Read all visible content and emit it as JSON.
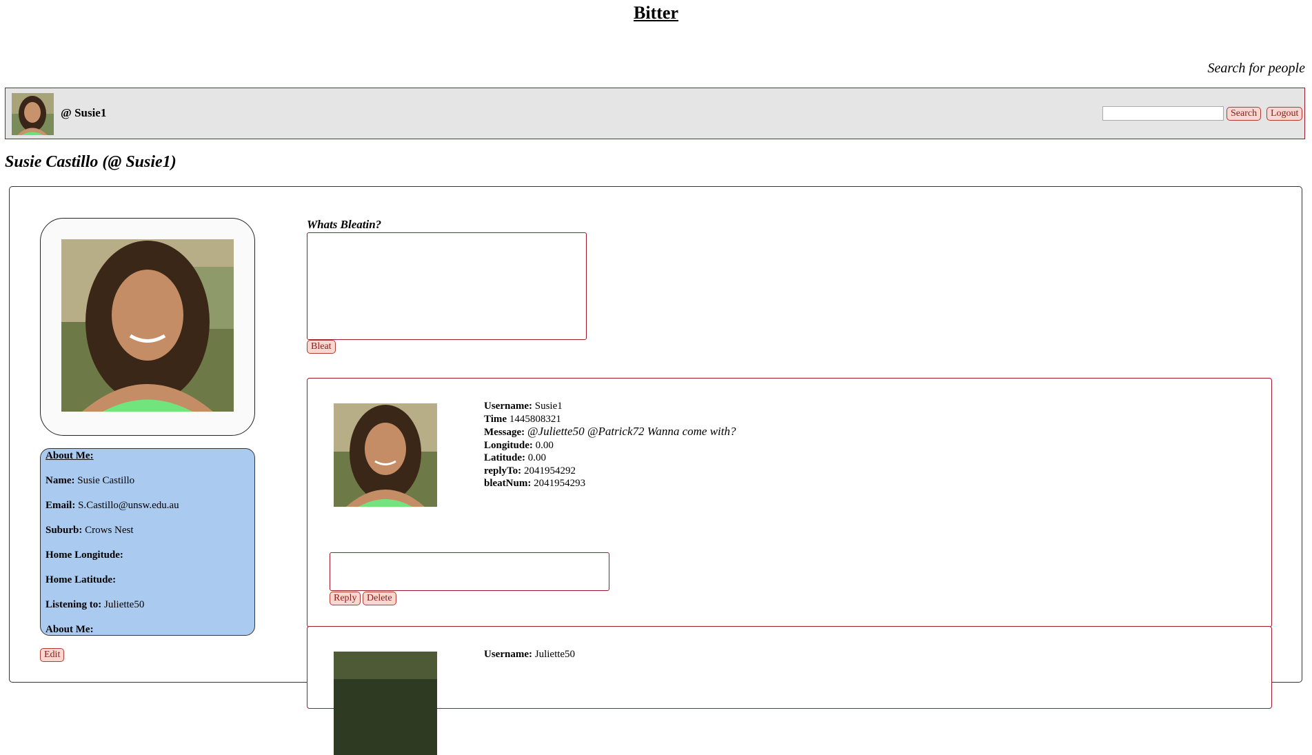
{
  "site": {
    "title": "Bitter"
  },
  "header": {
    "search_caption": "Search for people",
    "handle": "@ Susie1",
    "search_placeholder": "",
    "search_label": "Search",
    "logout_label": "Logout"
  },
  "profile": {
    "title": "Susie Castillo (@ Susie1)",
    "about": {
      "heading": "About Me:",
      "fields": [
        {
          "label": "Name:",
          "value": "Susie Castillo"
        },
        {
          "label": "Email:",
          "value": "S.Castillo@unsw.edu.au"
        },
        {
          "label": "Suburb:",
          "value": "Crows Nest"
        },
        {
          "label": "Home Longitude:",
          "value": ""
        },
        {
          "label": "Home Latitude:",
          "value": ""
        },
        {
          "label": "Listening to:",
          "value": "Juliette50"
        },
        {
          "label": "About Me:",
          "value": ""
        }
      ]
    },
    "edit_label": "Edit"
  },
  "compose": {
    "label": "Whats Bleatin?",
    "value": "",
    "button_label": "Bleat"
  },
  "bleats": [
    {
      "username_label": "Username:",
      "username": "Susie1",
      "time_label": "Time",
      "time": "1445808321",
      "message_label": "Message:",
      "message": "@Juliette50 @Patrick72 Wanna come with?",
      "longitude_label": "Longitude:",
      "longitude": "0.00",
      "latitude_label": "Latitude:",
      "latitude": "0.00",
      "replyto_label": "replyTo:",
      "replyto": "2041954292",
      "bleatnum_label": "bleatNum:",
      "bleatnum": "2041954293",
      "reply_label": "Reply",
      "delete_label": "Delete"
    },
    {
      "username_label": "Username:",
      "username": "Juliette50"
    }
  ],
  "colors": {
    "accent_border": "#a01828",
    "topbar_bg": "#e5e5e5",
    "about_bg": "#aacbef",
    "button_bg": "#f7d7cf"
  }
}
